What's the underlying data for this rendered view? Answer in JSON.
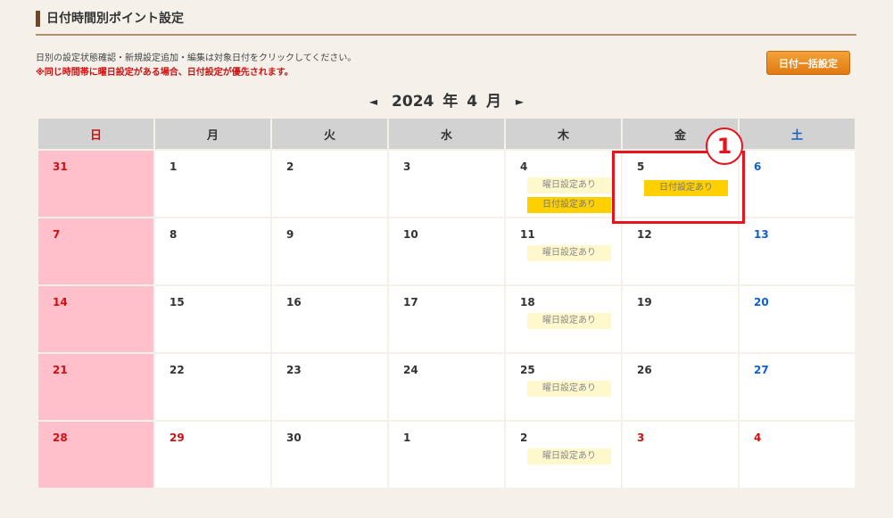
{
  "header": {
    "title": "日付時間別ポイント設定"
  },
  "notes": {
    "line1": "日別の設定状態確認・新規設定追加・編集は対象日付をクリックしてください。",
    "line2": "※同じ時間帯に曜日設定がある場合、日付設定が優先されます。"
  },
  "bulk_button": "日付一括設定",
  "month_nav": {
    "prev": "◄",
    "next": "►",
    "year": "2024",
    "year_unit": "年",
    "month": "4",
    "month_unit": "月"
  },
  "weekdays": [
    "日",
    "月",
    "火",
    "水",
    "木",
    "金",
    "土"
  ],
  "badges": {
    "weekday_setting": "曜日設定あり",
    "date_setting": "日付設定あり"
  },
  "weeks": [
    [
      "31",
      "1",
      "2",
      "3",
      "4",
      "5",
      "6"
    ],
    [
      "7",
      "8",
      "9",
      "10",
      "11",
      "12",
      "13"
    ],
    [
      "14",
      "15",
      "16",
      "17",
      "18",
      "19",
      "20"
    ],
    [
      "21",
      "22",
      "23",
      "24",
      "25",
      "26",
      "27"
    ],
    [
      "28",
      "29",
      "30",
      "1",
      "2",
      "3",
      "4"
    ]
  ],
  "annotation": {
    "callout_number": "1"
  },
  "colors": {
    "accent": "#e88a1a",
    "sunday_bg": "#ffc0cc",
    "holiday_red": "#d01010",
    "saturday_blue": "#1060c8",
    "highlight_red": "#e8131c"
  }
}
